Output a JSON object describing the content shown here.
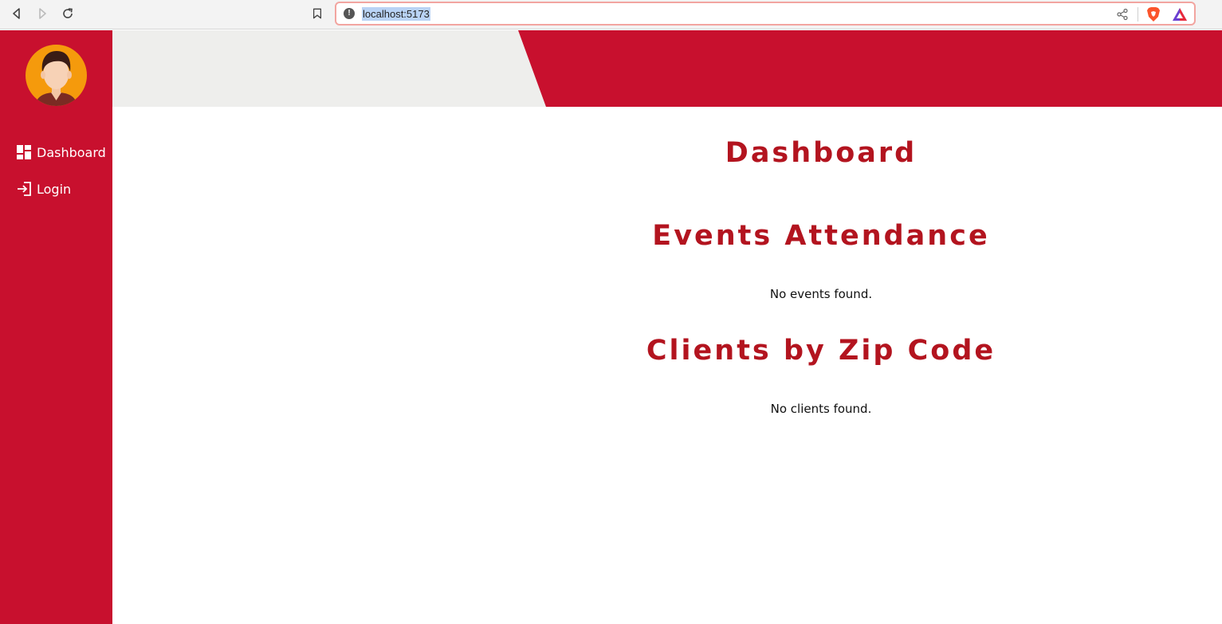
{
  "browser": {
    "url": "localhost:5173",
    "info_icon": "info-icon",
    "icons": [
      "back-icon",
      "forward-icon",
      "reload-icon",
      "bookmark-icon",
      "share-icon",
      "brave-shield-icon",
      "brave-rewards-icon"
    ]
  },
  "sidebar": {
    "items": [
      {
        "label": "Dashboard",
        "icon": "dashboard-icon"
      },
      {
        "label": "Login",
        "icon": "login-icon"
      }
    ]
  },
  "main": {
    "title": "Dashboard",
    "events_heading": "Events Attendance",
    "events_empty": "No events found.",
    "clients_heading": "Clients by Zip Code",
    "clients_empty": "No clients found."
  },
  "colors": {
    "brand_red": "#c8102e",
    "heading_red": "#b3141f",
    "header_gray": "#eeeeec"
  }
}
